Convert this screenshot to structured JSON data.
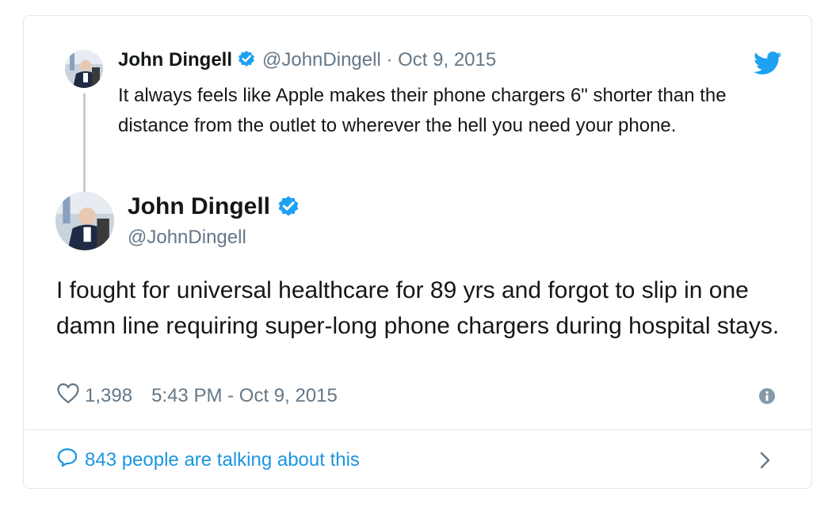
{
  "quoted": {
    "name": "John Dingell",
    "handle": "@JohnDingell",
    "separator": "·",
    "date": "Oct 9, 2015",
    "text": "It always feels like Apple makes their phone chargers 6\" shorter than the distance from the outlet to wherever the hell you need your phone."
  },
  "tweet": {
    "name": "John Dingell",
    "handle": "@JohnDingell",
    "text": "I fought for universal healthcare for 89 yrs and forgot to slip in one damn line requiring super-long phone chargers during hospital stays.",
    "likes": "1,398",
    "timestamp": "5:43 PM - Oct 9, 2015"
  },
  "footer": {
    "talking": "843 people are talking about this"
  },
  "colors": {
    "brand_blue": "#1da1f2",
    "link_blue": "#1b95e0",
    "muted_gray": "#657786",
    "border": "#e1e8ed"
  },
  "icons": [
    "verified-badge-icon",
    "twitter-bird-icon",
    "heart-icon",
    "info-icon",
    "speech-bubble-icon",
    "chevron-right-icon"
  ]
}
